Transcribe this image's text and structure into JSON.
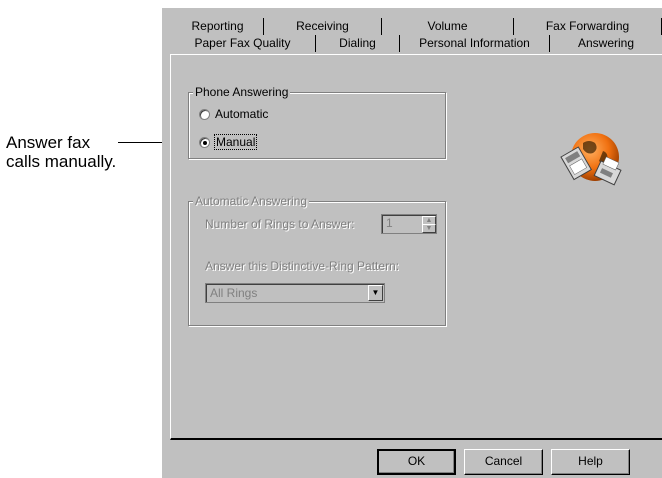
{
  "callout": {
    "text": "Answer fax calls manually."
  },
  "tabs": {
    "top": [
      "Reporting",
      "Receiving",
      "Volume",
      "Fax Forwarding"
    ],
    "bottom": [
      "Paper Fax Quality",
      "Dialing",
      "Personal Information",
      "Answering"
    ],
    "active": "Answering"
  },
  "phone_answering": {
    "title": "Phone Answering",
    "options": [
      {
        "label": "Automatic",
        "checked": false
      },
      {
        "label": "Manual",
        "checked": true
      }
    ]
  },
  "automatic_answering": {
    "title": "Automatic Answering",
    "rings_label": "Number of Rings to Answer:",
    "rings_value": "1",
    "pattern_label": "Answer this Distinctive-Ring Pattern:",
    "pattern_value": "All Rings",
    "enabled": false
  },
  "buttons": {
    "ok": "OK",
    "cancel": "Cancel",
    "help": "Help"
  },
  "icon": "globe-fax-machines-icon"
}
